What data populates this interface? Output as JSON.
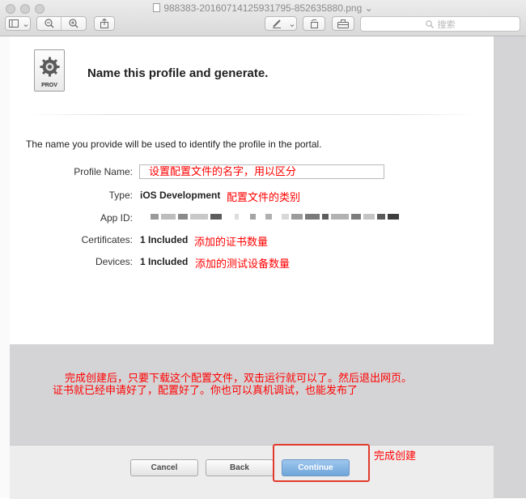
{
  "window": {
    "title": "988383-20160714125931795-852635880.png",
    "title_chevron": "⌄",
    "search_placeholder": "搜索"
  },
  "toolbar": {
    "sidebar_chevron": "⌄",
    "markup_chevron": "⌄"
  },
  "profile": {
    "icon_label": "PROV",
    "heading": "Name this profile and generate.",
    "description": "The name you provide will be used to identify the profile in the portal.",
    "fields": {
      "name_label": "Profile Name:",
      "name_value": "设置配置文件的名字，用以区分",
      "type_label": "Type:",
      "type_value": "iOS Development",
      "type_note": "配置文件的类别",
      "appid_label": "App ID:",
      "certs_label": "Certificates:",
      "certs_value": "1 Included",
      "certs_note": "添加的证书数量",
      "devices_label": "Devices:",
      "devices_value": "1 Included",
      "devices_note": "添加的测试设备数量"
    }
  },
  "annotation": {
    "line1": "完成创建后，只要下载这个配置文件，双击运行就可以了。然后退出网页。",
    "line2": "证书就已经申请好了，配置好了。你也可以真机调试，也能发布了",
    "side_note": "完成创建"
  },
  "buttons": {
    "cancel": "Cancel",
    "back": "Back",
    "continue": "Continue"
  },
  "colors": {
    "annotation_red": "#ff0000",
    "continue_blue": "#6fa5d9",
    "highlight_border": "#e23b2c"
  }
}
